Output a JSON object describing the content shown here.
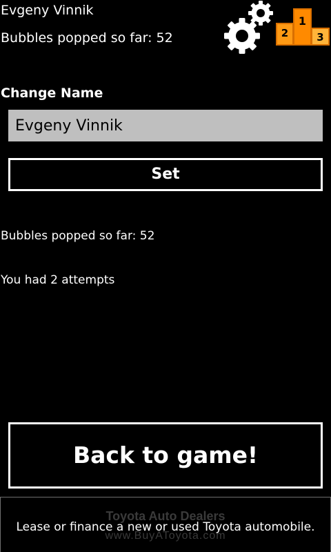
{
  "header": {
    "player_name": "Evgeny Vinnik",
    "bubbles_popped": "Bubbles popped so far: 52",
    "settings_icon": "gears-icon",
    "leaderboard_icon": "podium-icon",
    "podium": {
      "second": "2",
      "first": "1",
      "third": "3",
      "colors": {
        "first": "#ff8a00",
        "second": "#ff9a14",
        "third": "#ffb43a",
        "outline": "#d96f00"
      }
    }
  },
  "change_name": {
    "heading": "Change Name",
    "input_value": "Evgeny Vinnik",
    "set_label": "Set"
  },
  "stats": {
    "bubbles_popped": "Bubbles popped so far: 52",
    "attempts": "You had 2 attempts"
  },
  "back_button": {
    "label": "Back to game!"
  },
  "ad": {
    "headline": "Toyota Auto Dealers",
    "body": "Lease or finance a new or used Toyota automobile.",
    "url": "www.BuyAToyota.com"
  },
  "colors": {
    "background": "#000000",
    "text": "#ffffff",
    "input_background": "#bfbfbf"
  }
}
